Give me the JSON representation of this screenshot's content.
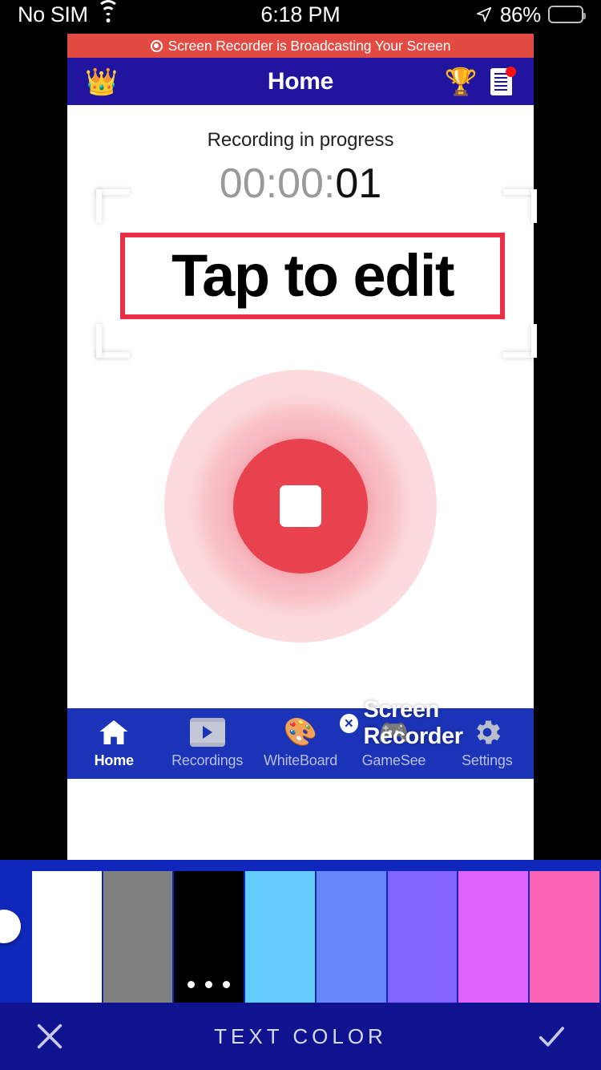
{
  "status_bar": {
    "carrier": "No SIM",
    "wifi_icon": "wifi-icon",
    "time": "6:18 PM",
    "location_icon": "location-arrow-icon",
    "battery_percent": "86%",
    "battery_icon": "battery-icon"
  },
  "broadcast": {
    "icon": "record-dot-icon",
    "message": "Screen Recorder is Broadcasting Your Screen",
    "bg_color": "#e24b42"
  },
  "navbar": {
    "title": "Home",
    "crown_icon": "crown-icon",
    "crown_glyph": "👑",
    "trophy_icon": "trophy-icon",
    "trophy_glyph": "🏆",
    "notes_icon": "notes-document-icon",
    "bg_color": "#21149e"
  },
  "main": {
    "status_text": "Recording in progress",
    "timer": {
      "hours": "00",
      "sep1": ":",
      "minutes": "00",
      "sep2": ":",
      "seconds": "01",
      "full": "00:00:01"
    },
    "record_button": {
      "name": "stop-recording-button",
      "color": "#e8424f",
      "inner_shape": "square"
    },
    "edit_overlay": {
      "text": "Tap to edit",
      "border_color": "#ed2f45",
      "text_color": "#000000",
      "bg_color": "#ffffff"
    }
  },
  "tabbar": {
    "bg_color": "#1b33b6",
    "items": [
      {
        "label": "Home",
        "icon": "home-icon",
        "active": true
      },
      {
        "label": "Recordings",
        "icon": "film-play-icon",
        "active": false
      },
      {
        "label": "WhiteBoard",
        "icon": "palette-icon",
        "glyph": "🎨",
        "active": false
      },
      {
        "label": "GameSee",
        "icon": "gamepad-icon",
        "glyph": "🎮",
        "active": false
      },
      {
        "label": "Settings",
        "icon": "gear-icon",
        "active": false
      }
    ]
  },
  "watermark": {
    "close_icon": "close-circle-icon",
    "close_glyph": "×",
    "text": "Screen Recorder"
  },
  "color_picker": {
    "bg_color": "#0f27ba",
    "eyedropper_icon": "eyedropper-icon",
    "title": "TEXT COLOR",
    "cancel_icon": "close-x-icon",
    "confirm_icon": "checkmark-icon",
    "selected_swatch_index": 2,
    "swatches": [
      {
        "name": "white",
        "color": "#ffffff",
        "selected": false
      },
      {
        "name": "gray",
        "color": "#818181",
        "selected": false
      },
      {
        "name": "black",
        "color": "#000000",
        "selected": true
      },
      {
        "name": "sky-blue",
        "color": "#62cbfb",
        "selected": false
      },
      {
        "name": "cornflower",
        "color": "#6987fb",
        "selected": false
      },
      {
        "name": "violet",
        "color": "#8263fb",
        "selected": false
      },
      {
        "name": "magenta",
        "color": "#df63fb",
        "selected": false
      },
      {
        "name": "pink",
        "color": "#fb63b5",
        "selected": false
      }
    ]
  }
}
